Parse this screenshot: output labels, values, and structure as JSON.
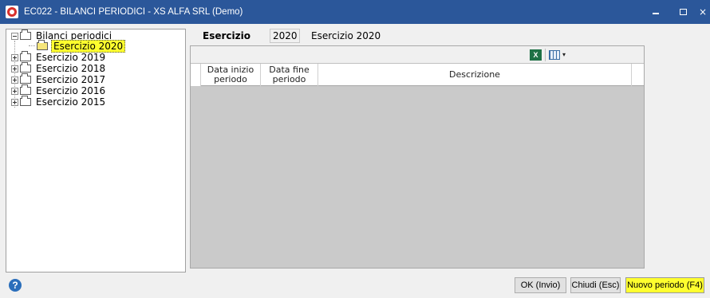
{
  "window": {
    "title": "EC022 - BILANCI PERIODICI - XS ALFA SRL  (Demo)",
    "minimize_glyph": "-",
    "maximize_glyph": "□",
    "close_glyph": "×"
  },
  "tree": {
    "root_label": "Bilanci periodici",
    "items": [
      {
        "label": "Esercizio 2020",
        "selected": true
      },
      {
        "label": "Esercizio 2019",
        "selected": false
      },
      {
        "label": "Esercizio 2018",
        "selected": false
      },
      {
        "label": "Esercizio 2017",
        "selected": false
      },
      {
        "label": "Esercizio 2016",
        "selected": false
      },
      {
        "label": "Esercizio 2015",
        "selected": false
      }
    ]
  },
  "header": {
    "esercizio_label": "Esercizio",
    "esercizio_year": "2020",
    "esercizio_desc": "Esercizio 2020"
  },
  "grid": {
    "excel_icon_label": "X",
    "dropdown_glyph": "▾",
    "columns": {
      "start": "Data inizio periodo",
      "end": "Data fine periodo",
      "desc": "Descrizione"
    },
    "rows": []
  },
  "footer": {
    "help_glyph": "?",
    "ok_label": "OK (Invio)",
    "close_label": "Chiudi (Esc)",
    "new_label": "Nuovo periodo (F4)"
  },
  "colors": {
    "titlebar": "#2b579a",
    "selection_highlight": "#ffff2e",
    "grid_background": "#cacaca"
  },
  "icons": [
    "app-icon",
    "folder-icon",
    "expander-icon",
    "excel-export-icon",
    "columns-icon",
    "help-icon"
  ]
}
